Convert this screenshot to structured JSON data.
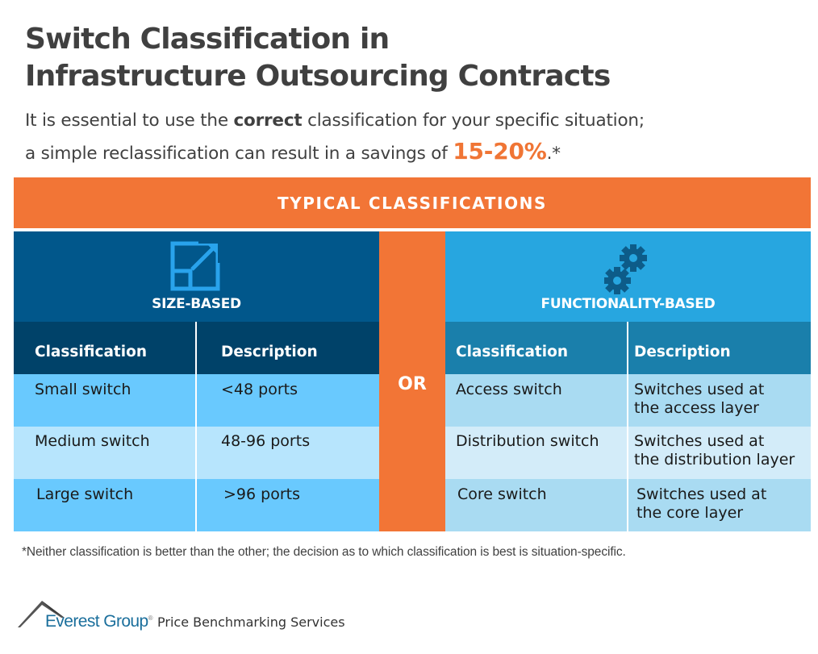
{
  "header": {
    "title_line1": "Switch Classification in",
    "title_line2": "Infrastructure Outsourcing Contracts",
    "subtitle_part1": "It is essential to use the ",
    "subtitle_bold": "correct",
    "subtitle_part2": " classification for your specific situation;",
    "subtitle_line2_part1": "a simple reclassification can result in a savings of ",
    "subtitle_highlight": "15-20%",
    "subtitle_line2_part2": ".*"
  },
  "band": {
    "label": "TYPICAL CLASSIFICATIONS"
  },
  "separator": {
    "label": "OR"
  },
  "size_based": {
    "icon": "resize-expand-icon",
    "label": "SIZE-BASED",
    "columns": [
      "Classification",
      "Description"
    ],
    "rows": [
      {
        "classification": "Small switch",
        "description": "<48 ports"
      },
      {
        "classification": "Medium switch",
        "description": "48-96 ports"
      },
      {
        "classification": "Large switch",
        "description": ">96 ports"
      }
    ]
  },
  "functionality_based": {
    "icon": "gears-icon",
    "label": "FUNCTIONALITY-BASED",
    "columns": [
      "Classification",
      "Description"
    ],
    "rows": [
      {
        "classification": "Access switch",
        "description_line1": "Switches used at",
        "description_line2": "the access layer"
      },
      {
        "classification": "Distribution switch",
        "description_line1": "Switches used at",
        "description_line2": "the distribution layer"
      },
      {
        "classification": "Core switch",
        "description_line1": "Switches used at",
        "description_line2": "the core layer"
      }
    ]
  },
  "footnote": "*Neither classification is better than the other; the decision as to which classification is best is situation-specific.",
  "footer": {
    "brand": "Everest Group",
    "registered": "®",
    "service": "Price Benchmarking Services"
  },
  "colors": {
    "accent_orange": "#f27536",
    "size_dark_blue": "#01578b",
    "size_header_blue": "#004269",
    "function_blue": "#27a6e0",
    "function_header_blue": "#1a7fab"
  }
}
